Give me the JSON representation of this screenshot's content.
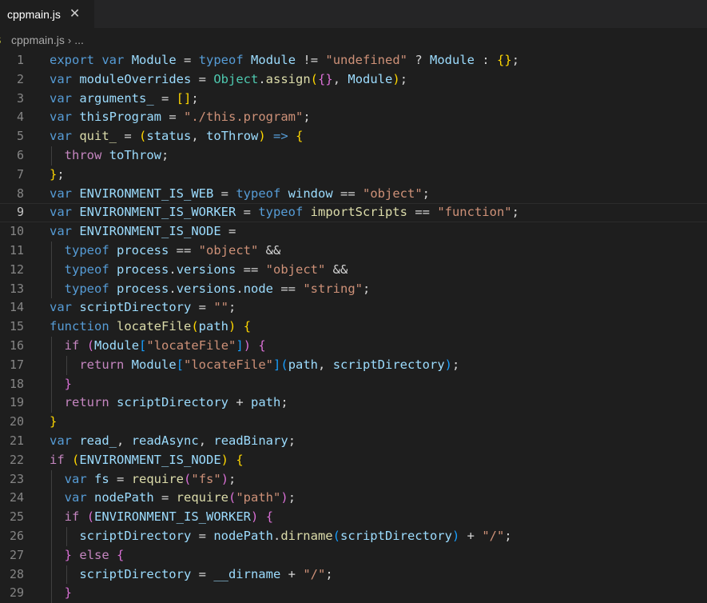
{
  "tab": {
    "label": "cppmain.js",
    "close_glyph": "✕"
  },
  "breadcrumb": {
    "icon_text": "JS",
    "file": "cppmain.js",
    "separator": "›",
    "more": "..."
  },
  "colors": {
    "background": "#1e1e1e",
    "keyword": "#569cd6",
    "control": "#c586c0",
    "variable": "#9cdcfe",
    "function": "#dcdcaa",
    "string": "#ce9178",
    "class": "#4ec9b0",
    "bracket1": "#ffd700",
    "bracket2": "#da70d6",
    "bracket3": "#179fff"
  },
  "editor": {
    "current_line": 9,
    "lines": [
      {
        "n": "1",
        "tokens": [
          [
            "kw",
            "export"
          ],
          [
            "pl",
            " "
          ],
          [
            "kw",
            "var"
          ],
          [
            "pl",
            " "
          ],
          [
            "vr",
            "Module"
          ],
          [
            "pl",
            " = "
          ],
          [
            "kw",
            "typeof"
          ],
          [
            "pl",
            " "
          ],
          [
            "vr",
            "Module"
          ],
          [
            "pl",
            " != "
          ],
          [
            "str",
            "\"undefined\""
          ],
          [
            "pl",
            " ? "
          ],
          [
            "vr",
            "Module"
          ],
          [
            "pl",
            " : "
          ],
          [
            "b1",
            "{}"
          ],
          [
            "pl",
            ";"
          ]
        ]
      },
      {
        "n": "2",
        "tokens": [
          [
            "kw",
            "var"
          ],
          [
            "pl",
            " "
          ],
          [
            "vr",
            "moduleOverrides"
          ],
          [
            "pl",
            " = "
          ],
          [
            "cls",
            "Object"
          ],
          [
            "pl",
            "."
          ],
          [
            "fn",
            "assign"
          ],
          [
            "b1",
            "("
          ],
          [
            "b2",
            "{}"
          ],
          [
            "pl",
            ", "
          ],
          [
            "vr",
            "Module"
          ],
          [
            "b1",
            ")"
          ],
          [
            "pl",
            ";"
          ]
        ]
      },
      {
        "n": "3",
        "tokens": [
          [
            "kw",
            "var"
          ],
          [
            "pl",
            " "
          ],
          [
            "vr",
            "arguments_"
          ],
          [
            "pl",
            " = "
          ],
          [
            "b1",
            "[]"
          ],
          [
            "pl",
            ";"
          ]
        ]
      },
      {
        "n": "4",
        "tokens": [
          [
            "kw",
            "var"
          ],
          [
            "pl",
            " "
          ],
          [
            "vr",
            "thisProgram"
          ],
          [
            "pl",
            " = "
          ],
          [
            "str",
            "\"./this.program\""
          ],
          [
            "pl",
            ";"
          ]
        ]
      },
      {
        "n": "5",
        "tokens": [
          [
            "kw",
            "var"
          ],
          [
            "pl",
            " "
          ],
          [
            "fn",
            "quit_"
          ],
          [
            "pl",
            " = "
          ],
          [
            "b1",
            "("
          ],
          [
            "vr",
            "status"
          ],
          [
            "pl",
            ", "
          ],
          [
            "vr",
            "toThrow"
          ],
          [
            "b1",
            ")"
          ],
          [
            "pl",
            " "
          ],
          [
            "kw",
            "=>"
          ],
          [
            "pl",
            " "
          ],
          [
            "b1",
            "{"
          ]
        ]
      },
      {
        "n": "6",
        "indent": 1,
        "tokens": [
          [
            "pl",
            "  "
          ],
          [
            "ctl",
            "throw"
          ],
          [
            "pl",
            " "
          ],
          [
            "vr",
            "toThrow"
          ],
          [
            "pl",
            ";"
          ]
        ]
      },
      {
        "n": "7",
        "tokens": [
          [
            "b1",
            "}"
          ],
          [
            "pl",
            ";"
          ]
        ]
      },
      {
        "n": "8",
        "tokens": [
          [
            "kw",
            "var"
          ],
          [
            "pl",
            " "
          ],
          [
            "vr",
            "ENVIRONMENT_IS_WEB"
          ],
          [
            "pl",
            " = "
          ],
          [
            "kw",
            "typeof"
          ],
          [
            "pl",
            " "
          ],
          [
            "vr",
            "window"
          ],
          [
            "pl",
            " == "
          ],
          [
            "str",
            "\"object\""
          ],
          [
            "pl",
            ";"
          ]
        ]
      },
      {
        "n": "9",
        "tokens": [
          [
            "kw",
            "var"
          ],
          [
            "pl",
            " "
          ],
          [
            "vr",
            "ENVIRONMENT_IS_WORKER"
          ],
          [
            "pl",
            " = "
          ],
          [
            "kw",
            "typeof"
          ],
          [
            "pl",
            " "
          ],
          [
            "fn",
            "importScripts"
          ],
          [
            "pl",
            " == "
          ],
          [
            "str",
            "\"function\""
          ],
          [
            "pl",
            ";"
          ]
        ]
      },
      {
        "n": "10",
        "tokens": [
          [
            "kw",
            "var"
          ],
          [
            "pl",
            " "
          ],
          [
            "vr",
            "ENVIRONMENT_IS_NODE"
          ],
          [
            "pl",
            " ="
          ]
        ]
      },
      {
        "n": "11",
        "indent": 1,
        "tokens": [
          [
            "pl",
            "  "
          ],
          [
            "kw",
            "typeof"
          ],
          [
            "pl",
            " "
          ],
          [
            "vr",
            "process"
          ],
          [
            "pl",
            " == "
          ],
          [
            "str",
            "\"object\""
          ],
          [
            "pl",
            " &&"
          ]
        ]
      },
      {
        "n": "12",
        "indent": 1,
        "tokens": [
          [
            "pl",
            "  "
          ],
          [
            "kw",
            "typeof"
          ],
          [
            "pl",
            " "
          ],
          [
            "vr",
            "process"
          ],
          [
            "pl",
            "."
          ],
          [
            "vr",
            "versions"
          ],
          [
            "pl",
            " == "
          ],
          [
            "str",
            "\"object\""
          ],
          [
            "pl",
            " &&"
          ]
        ]
      },
      {
        "n": "13",
        "indent": 1,
        "tokens": [
          [
            "pl",
            "  "
          ],
          [
            "kw",
            "typeof"
          ],
          [
            "pl",
            " "
          ],
          [
            "vr",
            "process"
          ],
          [
            "pl",
            "."
          ],
          [
            "vr",
            "versions"
          ],
          [
            "pl",
            "."
          ],
          [
            "vr",
            "node"
          ],
          [
            "pl",
            " == "
          ],
          [
            "str",
            "\"string\""
          ],
          [
            "pl",
            ";"
          ]
        ]
      },
      {
        "n": "14",
        "tokens": [
          [
            "kw",
            "var"
          ],
          [
            "pl",
            " "
          ],
          [
            "vr",
            "scriptDirectory"
          ],
          [
            "pl",
            " = "
          ],
          [
            "str",
            "\"\""
          ],
          [
            "pl",
            ";"
          ]
        ]
      },
      {
        "n": "15",
        "tokens": [
          [
            "kw",
            "function"
          ],
          [
            "pl",
            " "
          ],
          [
            "fn",
            "locateFile"
          ],
          [
            "b1",
            "("
          ],
          [
            "vr",
            "path"
          ],
          [
            "b1",
            ")"
          ],
          [
            "pl",
            " "
          ],
          [
            "b1",
            "{"
          ]
        ]
      },
      {
        "n": "16",
        "indent": 1,
        "tokens": [
          [
            "pl",
            "  "
          ],
          [
            "ctl",
            "if"
          ],
          [
            "pl",
            " "
          ],
          [
            "b2",
            "("
          ],
          [
            "vr",
            "Module"
          ],
          [
            "b3",
            "["
          ],
          [
            "str",
            "\"locateFile\""
          ],
          [
            "b3",
            "]"
          ],
          [
            "b2",
            ")"
          ],
          [
            "pl",
            " "
          ],
          [
            "b2",
            "{"
          ]
        ]
      },
      {
        "n": "17",
        "indent": 2,
        "tokens": [
          [
            "pl",
            "    "
          ],
          [
            "ctl",
            "return"
          ],
          [
            "pl",
            " "
          ],
          [
            "vr",
            "Module"
          ],
          [
            "b3",
            "["
          ],
          [
            "str",
            "\"locateFile\""
          ],
          [
            "b3",
            "]"
          ],
          [
            "b3",
            "("
          ],
          [
            "vr",
            "path"
          ],
          [
            "pl",
            ", "
          ],
          [
            "vr",
            "scriptDirectory"
          ],
          [
            "b3",
            ")"
          ],
          [
            "pl",
            ";"
          ]
        ]
      },
      {
        "n": "18",
        "indent": 1,
        "tokens": [
          [
            "pl",
            "  "
          ],
          [
            "b2",
            "}"
          ]
        ]
      },
      {
        "n": "19",
        "indent": 1,
        "tokens": [
          [
            "pl",
            "  "
          ],
          [
            "ctl",
            "return"
          ],
          [
            "pl",
            " "
          ],
          [
            "vr",
            "scriptDirectory"
          ],
          [
            "pl",
            " + "
          ],
          [
            "vr",
            "path"
          ],
          [
            "pl",
            ";"
          ]
        ]
      },
      {
        "n": "20",
        "tokens": [
          [
            "b1",
            "}"
          ]
        ]
      },
      {
        "n": "21",
        "tokens": [
          [
            "kw",
            "var"
          ],
          [
            "pl",
            " "
          ],
          [
            "vr",
            "read_"
          ],
          [
            "pl",
            ", "
          ],
          [
            "vr",
            "readAsync"
          ],
          [
            "pl",
            ", "
          ],
          [
            "vr",
            "readBinary"
          ],
          [
            "pl",
            ";"
          ]
        ]
      },
      {
        "n": "22",
        "tokens": [
          [
            "ctl",
            "if"
          ],
          [
            "pl",
            " "
          ],
          [
            "b1",
            "("
          ],
          [
            "vr",
            "ENVIRONMENT_IS_NODE"
          ],
          [
            "b1",
            ")"
          ],
          [
            "pl",
            " "
          ],
          [
            "b1",
            "{"
          ]
        ]
      },
      {
        "n": "23",
        "indent": 1,
        "tokens": [
          [
            "pl",
            "  "
          ],
          [
            "kw",
            "var"
          ],
          [
            "pl",
            " "
          ],
          [
            "vr",
            "fs"
          ],
          [
            "pl",
            " = "
          ],
          [
            "fn",
            "require"
          ],
          [
            "b2",
            "("
          ],
          [
            "str",
            "\"fs\""
          ],
          [
            "b2",
            ")"
          ],
          [
            "pl",
            ";"
          ]
        ]
      },
      {
        "n": "24",
        "indent": 1,
        "tokens": [
          [
            "pl",
            "  "
          ],
          [
            "kw",
            "var"
          ],
          [
            "pl",
            " "
          ],
          [
            "vr",
            "nodePath"
          ],
          [
            "pl",
            " = "
          ],
          [
            "fn",
            "require"
          ],
          [
            "b2",
            "("
          ],
          [
            "str",
            "\"path\""
          ],
          [
            "b2",
            ")"
          ],
          [
            "pl",
            ";"
          ]
        ]
      },
      {
        "n": "25",
        "indent": 1,
        "tokens": [
          [
            "pl",
            "  "
          ],
          [
            "ctl",
            "if"
          ],
          [
            "pl",
            " "
          ],
          [
            "b2",
            "("
          ],
          [
            "vr",
            "ENVIRONMENT_IS_WORKER"
          ],
          [
            "b2",
            ")"
          ],
          [
            "pl",
            " "
          ],
          [
            "b2",
            "{"
          ]
        ]
      },
      {
        "n": "26",
        "indent": 2,
        "tokens": [
          [
            "pl",
            "    "
          ],
          [
            "vr",
            "scriptDirectory"
          ],
          [
            "pl",
            " = "
          ],
          [
            "vr",
            "nodePath"
          ],
          [
            "pl",
            "."
          ],
          [
            "fn",
            "dirname"
          ],
          [
            "b3",
            "("
          ],
          [
            "vr",
            "scriptDirectory"
          ],
          [
            "b3",
            ")"
          ],
          [
            "pl",
            " + "
          ],
          [
            "str",
            "\"/\""
          ],
          [
            "pl",
            ";"
          ]
        ]
      },
      {
        "n": "27",
        "indent": 1,
        "tokens": [
          [
            "pl",
            "  "
          ],
          [
            "b2",
            "}"
          ],
          [
            "pl",
            " "
          ],
          [
            "ctl",
            "else"
          ],
          [
            "pl",
            " "
          ],
          [
            "b2",
            "{"
          ]
        ]
      },
      {
        "n": "28",
        "indent": 2,
        "tokens": [
          [
            "pl",
            "    "
          ],
          [
            "vr",
            "scriptDirectory"
          ],
          [
            "pl",
            " = "
          ],
          [
            "vr",
            "__dirname"
          ],
          [
            "pl",
            " + "
          ],
          [
            "str",
            "\"/\""
          ],
          [
            "pl",
            ";"
          ]
        ]
      },
      {
        "n": "29",
        "indent": 1,
        "tokens": [
          [
            "pl",
            "  "
          ],
          [
            "b2",
            "}"
          ]
        ]
      }
    ]
  }
}
